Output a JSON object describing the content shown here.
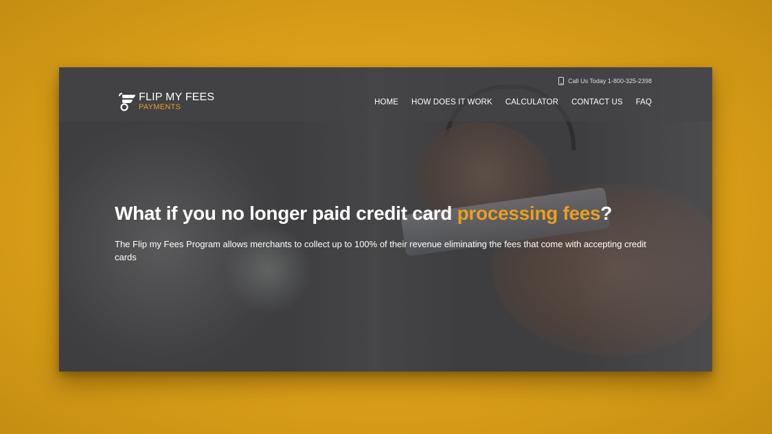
{
  "colors": {
    "accent": "#e8a020",
    "background": "#dba019"
  },
  "topbar": {
    "phone_text": "Call Us Today 1-800-325-2398",
    "icon": "mobile-phone-icon"
  },
  "logo": {
    "line1": "FLIP MY FEES",
    "line2": "PAYMENTS",
    "icon": "flip-logo-icon"
  },
  "nav": {
    "items": [
      {
        "label": "HOME"
      },
      {
        "label": "HOW DOES IT WORK"
      },
      {
        "label": "CALCULATOR"
      },
      {
        "label": "CONTACT US"
      },
      {
        "label": "FAQ"
      }
    ]
  },
  "hero": {
    "title_prefix": "What if you no longer paid credit card ",
    "title_accent": "processing fees",
    "title_suffix": "?",
    "subtitle": "The Flip my Fees Program allows merchants to collect up to 100% of their revenue eliminating the fees that come with accepting credit cards"
  }
}
